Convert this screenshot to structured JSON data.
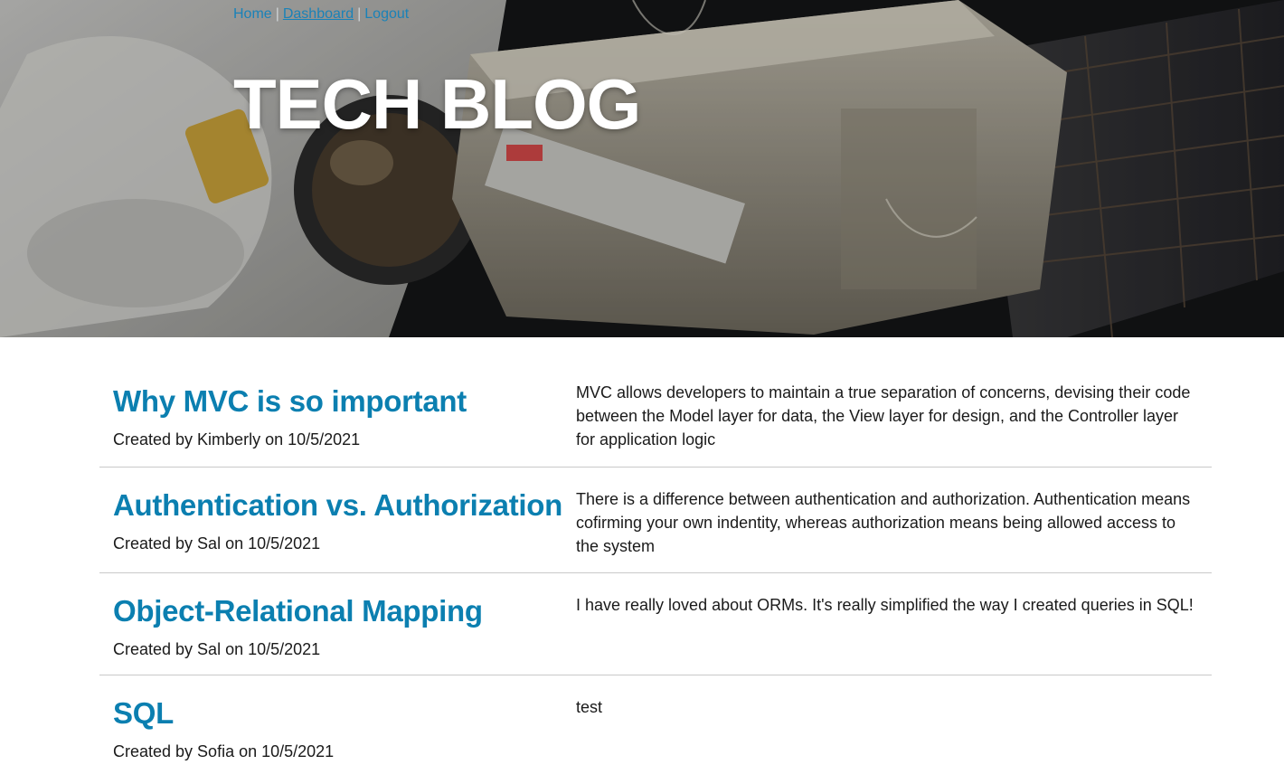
{
  "nav": {
    "home": "Home",
    "dashboard": "Dashboard",
    "logout": "Logout",
    "separator": "|"
  },
  "site": {
    "title": "TECH BLOG"
  },
  "posts": [
    {
      "title": "Why MVC is so important",
      "meta": "Created by Kimberly on 10/5/2021",
      "body": "MVC allows developers to maintain a true separation of concerns, devising their code between the Model layer for data, the View layer for design, and the Controller layer for application logic"
    },
    {
      "title": "Authentication vs. Authorization",
      "meta": "Created by Sal on 10/5/2021",
      "body": "There is a difference between authentication and authorization. Authentication means cofirming your own indentity, whereas authorization means being allowed access to the system"
    },
    {
      "title": "Object-Relational Mapping",
      "meta": "Created by Sal on 10/5/2021",
      "body": "I have really loved about ORMs. It's really simplified the way I created queries in SQL!"
    },
    {
      "title": "SQL",
      "meta": "Created by Sofia on 10/5/2021",
      "body": "test"
    }
  ],
  "colors": {
    "link": "#1a82b8",
    "post_title": "#0b7fb0",
    "divider": "#c9c9c9"
  }
}
